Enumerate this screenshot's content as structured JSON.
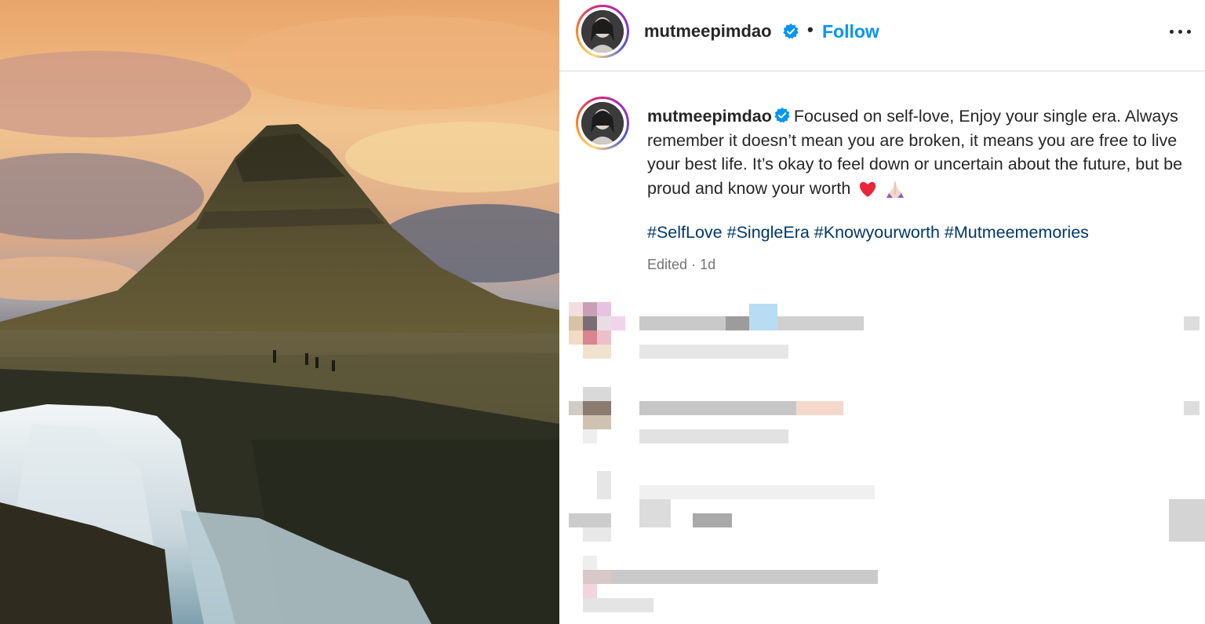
{
  "post": {
    "header": {
      "username": "mutmeepimdao",
      "separator": "•",
      "follow_label": "Follow"
    },
    "caption": {
      "username": "mutmeepimdao",
      "text": "Focused on self-love, Enjoy your single era. Always remember it doesn’t mean you are broken, it means you are free to live your best life. It’s okay to feel down or uncertain about the future, but be proud and know your worth",
      "emojis": [
        "heart-emoji",
        "praying-hands-emoji"
      ],
      "hashtags": [
        "#SelfLove",
        "#SingleEra",
        "#Knowyourworth",
        "#Mutmeememories"
      ],
      "edited_label": "Edited",
      "meta_separator": "·",
      "age": "1d"
    },
    "comments": {
      "censored": true,
      "count_visible": 4
    }
  },
  "colors": {
    "follow_blue": "#0095f6",
    "hashtag_blue": "#00376b",
    "verified_blue": "#0095f6",
    "muted_text": "#737373"
  },
  "icons": {
    "verified": "verified-badge-icon",
    "more": "more-options-icon"
  }
}
